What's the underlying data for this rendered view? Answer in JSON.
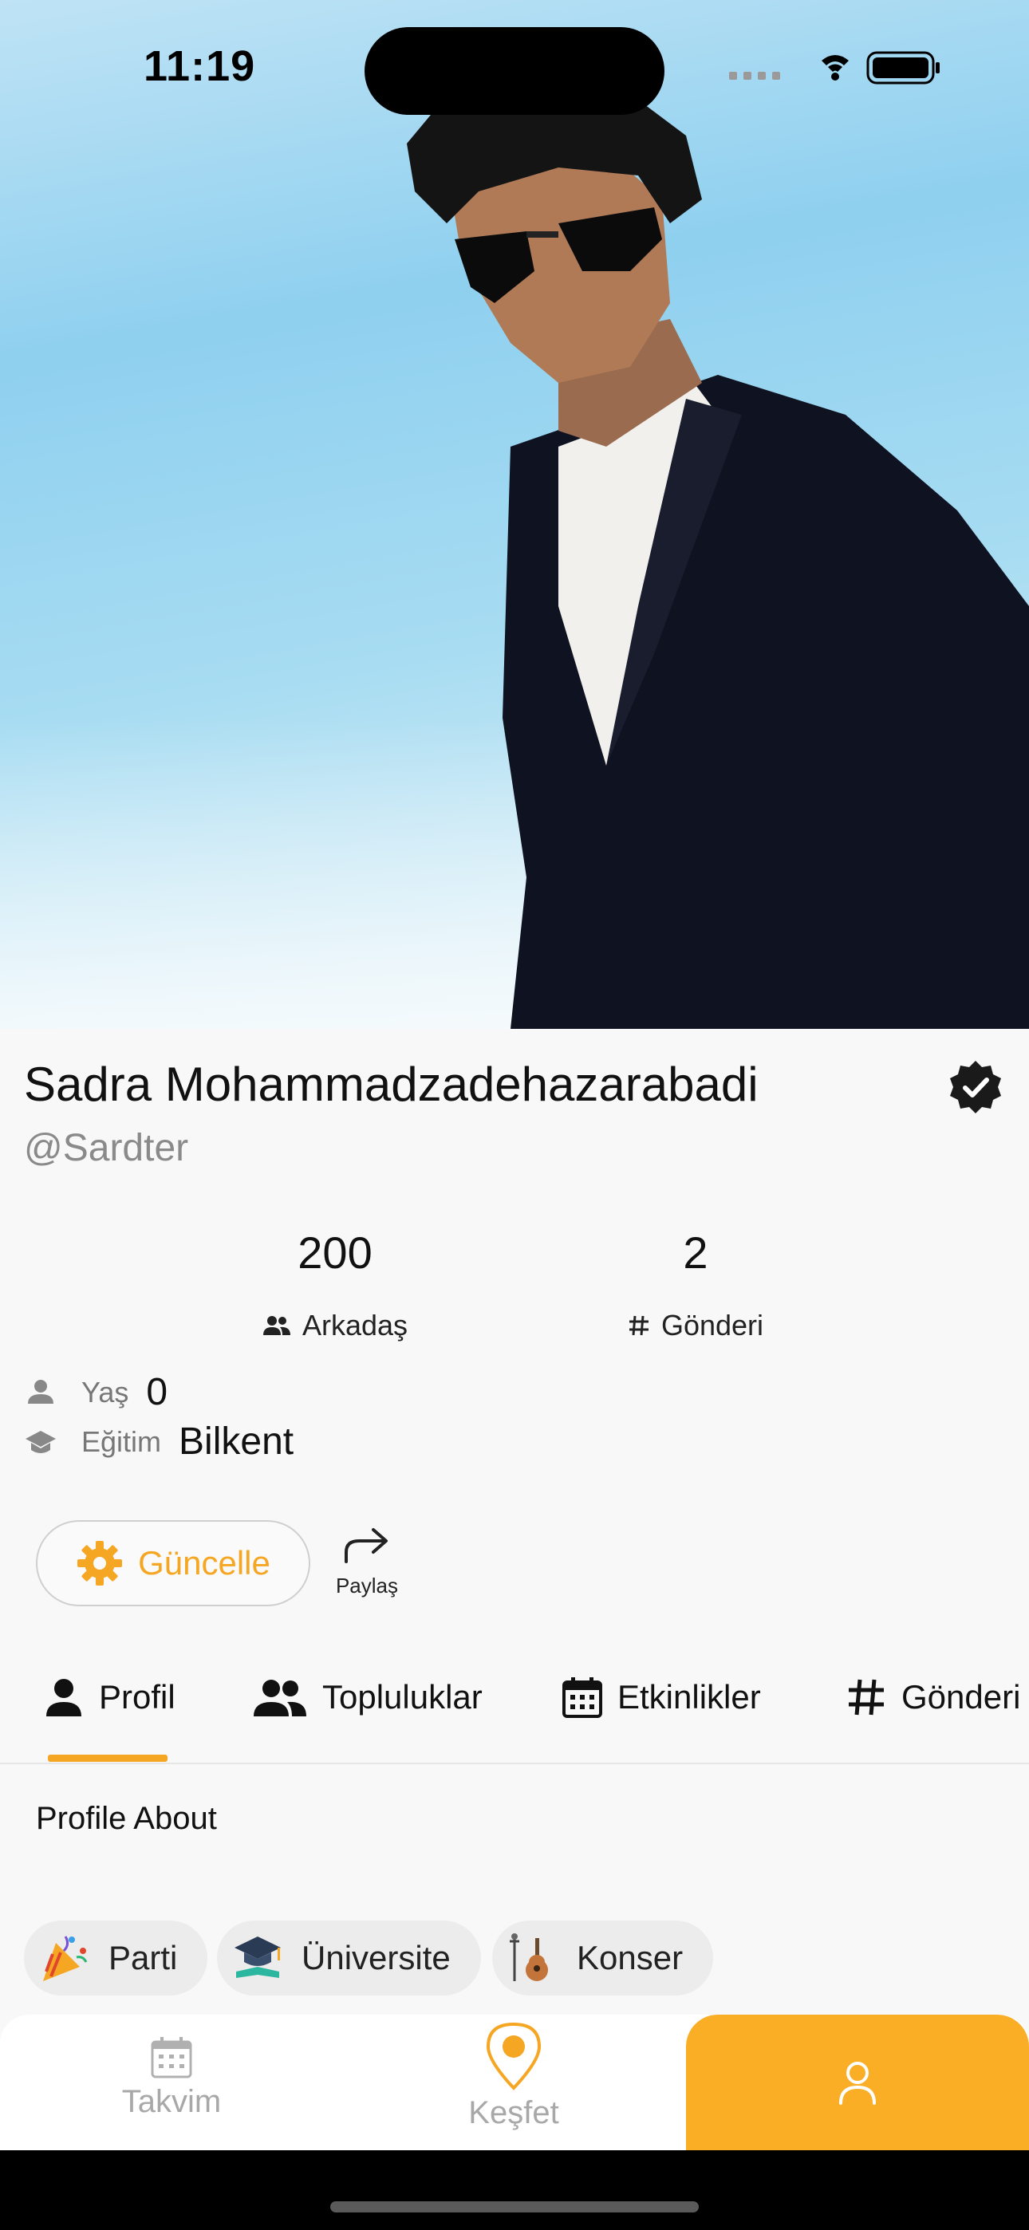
{
  "status_bar": {
    "time": "11:19"
  },
  "profile": {
    "name": "Sadra Mohammadzadehazarabadi",
    "handle": "@Sardter",
    "verified_icon": "verified-badge-icon"
  },
  "stats": {
    "friends": {
      "value": "200",
      "label": "Arkadaş",
      "icon": "people-icon"
    },
    "posts": {
      "value": "2",
      "label": "Gönderi",
      "icon": "hashtag-icon"
    }
  },
  "info": {
    "age": {
      "label": "Yaş",
      "value": "0",
      "icon": "person-icon"
    },
    "education": {
      "label": "Eğitim",
      "value": "Bilkent",
      "icon": "graduation-cap-icon"
    }
  },
  "actions": {
    "update_label": "Güncelle",
    "share_label": "Paylaş"
  },
  "tabs": [
    {
      "label": "Profil",
      "icon": "person-icon",
      "active": true
    },
    {
      "label": "Topluluklar",
      "icon": "people-icon",
      "active": false
    },
    {
      "label": "Etkinlikler",
      "icon": "calendar-icon",
      "active": false
    },
    {
      "label": "Gönderi",
      "icon": "hashtag-icon",
      "active": false
    }
  ],
  "about_title": "Profile About",
  "chips": [
    {
      "label": "Parti",
      "icon": "party-popper-icon"
    },
    {
      "label": "Üniversite",
      "icon": "graduation-icon"
    },
    {
      "label": "Konser",
      "icon": "guitar-icon"
    }
  ],
  "bottom_nav": [
    {
      "label": "Takvim",
      "icon": "calendar-icon"
    },
    {
      "label": "Keşfet",
      "icon": "map-pin-icon"
    },
    {
      "label": "",
      "icon": "user-icon",
      "active": true
    }
  ],
  "colors": {
    "accent": "#f9ae25",
    "background": "#f8f8f8",
    "muted": "#8a8a8a"
  }
}
